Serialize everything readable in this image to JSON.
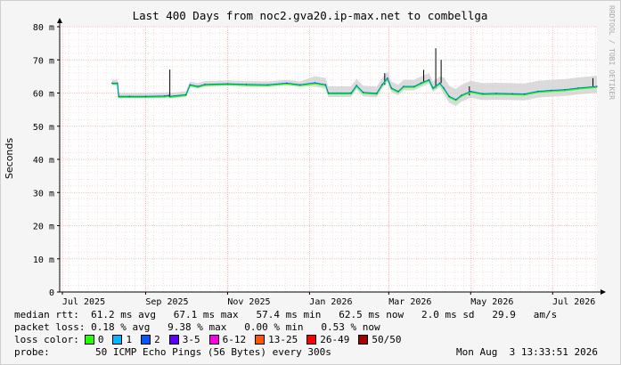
{
  "chart_data": {
    "type": "line",
    "title": "Last 400 Days from noc2.gva20.ip-max.net to combellga",
    "ylabel": "Seconds",
    "ylim": [
      0,
      80
    ],
    "yticks": [
      "0",
      "10 m",
      "20 m",
      "30 m",
      "40 m",
      "50 m",
      "60 m",
      "70 m",
      "80 m"
    ],
    "xticks": [
      "Jul 2025",
      "Sep 2025",
      "Nov 2025",
      "Jan 2026",
      "Mar 2026",
      "May 2026",
      "Jul 2026"
    ],
    "xtick_dates": [
      "2025-07-01",
      "2025-09-01",
      "2025-11-01",
      "2026-01-01",
      "2026-03-01",
      "2026-05-01",
      "2026-07-01"
    ],
    "x_range": [
      "2025-06-29",
      "2026-08-03"
    ],
    "grid": true,
    "series": [
      {
        "median_rtt_ms": [
          [
            "2025-08-07",
            63.0
          ],
          [
            "2025-08-11",
            63.0
          ],
          [
            "2025-08-12",
            59.0
          ],
          [
            "2025-08-20",
            59.0
          ],
          [
            "2025-09-01",
            59.0
          ],
          [
            "2025-09-15",
            59.1
          ],
          [
            "2025-09-18",
            59.3
          ],
          [
            "2025-09-19",
            59.0
          ],
          [
            "2025-10-01",
            59.5
          ],
          [
            "2025-10-04",
            62.5
          ],
          [
            "2025-10-10",
            62.0
          ],
          [
            "2025-10-15",
            62.6
          ],
          [
            "2025-11-01",
            62.8
          ],
          [
            "2025-11-15",
            62.6
          ],
          [
            "2025-12-01",
            62.5
          ],
          [
            "2025-12-15",
            63.0
          ],
          [
            "2025-12-25",
            62.5
          ],
          [
            "2026-01-05",
            63.1
          ],
          [
            "2026-01-13",
            62.5
          ],
          [
            "2026-01-15",
            60.0
          ],
          [
            "2026-02-01",
            60.0
          ],
          [
            "2026-02-05",
            62.3
          ],
          [
            "2026-02-10",
            60.2
          ],
          [
            "2026-02-20",
            59.9
          ],
          [
            "2026-02-24",
            62.5
          ],
          [
            "2026-02-28",
            64.5
          ],
          [
            "2026-03-03",
            61.5
          ],
          [
            "2026-03-08",
            60.5
          ],
          [
            "2026-03-12",
            62.0
          ],
          [
            "2026-03-20",
            62.0
          ],
          [
            "2026-03-25",
            63.0
          ],
          [
            "2026-03-31",
            64.0
          ],
          [
            "2026-04-03",
            61.5
          ],
          [
            "2026-04-08",
            63.0
          ],
          [
            "2026-04-11",
            61.5
          ],
          [
            "2026-04-15",
            59.0
          ],
          [
            "2026-04-20",
            58.0
          ],
          [
            "2026-04-24",
            59.3
          ],
          [
            "2026-05-01",
            60.5
          ],
          [
            "2026-05-10",
            59.8
          ],
          [
            "2026-05-20",
            59.9
          ],
          [
            "2026-06-01",
            59.8
          ],
          [
            "2026-06-10",
            59.7
          ],
          [
            "2026-06-20",
            60.5
          ],
          [
            "2026-06-30",
            60.8
          ],
          [
            "2026-07-10",
            61.0
          ],
          [
            "2026-07-20",
            61.5
          ],
          [
            "2026-08-03",
            62.0
          ]
        ],
        "spikes_max_ms": [
          [
            "2025-09-19",
            67.1
          ],
          [
            "2026-02-26",
            66.0
          ],
          [
            "2026-03-27",
            67.0
          ],
          [
            "2026-04-05",
            73.5
          ],
          [
            "2026-04-09",
            70.0
          ],
          [
            "2026-04-30",
            62.0
          ],
          [
            "2026-07-31",
            64.5
          ]
        ]
      }
    ]
  },
  "stats": {
    "median_rtt": "median rtt:  61.2 ms avg   67.1 ms max   57.4 ms min   62.5 ms now   2.0 ms sd   29.9   am/s",
    "packet_loss": "packet loss: 0.18 % avg   9.38 % max   0.00 % min   0.53 % now",
    "loss_color_label": "loss color:",
    "probe_label": "probe:",
    "probe_text": "50 ICMP Echo Pings (56 Bytes) every 300s",
    "timestamp": "Mon Aug  3 13:33:51 2026"
  },
  "legend": [
    {
      "label": "0",
      "color": "#26ff00"
    },
    {
      "label": "1",
      "color": "#00b8ff"
    },
    {
      "label": "2",
      "color": "#0059ff"
    },
    {
      "label": "3-5",
      "color": "#5e00ff"
    },
    {
      "label": "6-12",
      "color": "#ff00e6"
    },
    {
      "label": "13-25",
      "color": "#ff5500"
    },
    {
      "label": "26-49",
      "color": "#ff0000"
    },
    {
      "label": "50/50",
      "color": "#a10000"
    }
  ],
  "watermark": "RRDTOOL / TOBI OETIKER"
}
